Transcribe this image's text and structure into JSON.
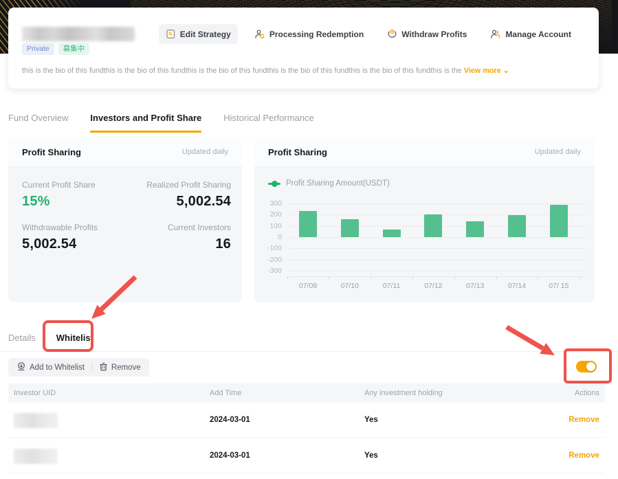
{
  "header": {
    "badges": [
      {
        "label": "Private"
      },
      {
        "label": "募集中"
      }
    ],
    "bio": "this is the bio of this fundthis is the bio of this fundthis is the bio of this fundthis is the bio of this fundthis is the bio of this fundthis is the",
    "view_more": "View more",
    "actions": [
      {
        "label": "Edit Strategy",
        "icon": "edit-strategy-icon"
      },
      {
        "label": "Processing Redemption",
        "icon": "processing-redemption-icon"
      },
      {
        "label": "Withdraw Profits",
        "icon": "withdraw-profits-icon"
      },
      {
        "label": "Manage Account",
        "icon": "manage-account-icon"
      }
    ]
  },
  "tabs": {
    "items": [
      {
        "label": "Fund Overview",
        "active": false
      },
      {
        "label": "Investors and Profit Share",
        "active": true
      },
      {
        "label": "Historical Performance",
        "active": false
      }
    ]
  },
  "stats_card": {
    "title": "Profit Sharing",
    "updated": "Updated daily",
    "items": [
      {
        "label": "Current Profit Share",
        "value": "15%"
      },
      {
        "label": "Realized Profit Sharing",
        "value": "5,002.54"
      },
      {
        "label": "Withdrawable Profits",
        "value": "5,002.54"
      },
      {
        "label": "Current Investors",
        "value": "16"
      }
    ]
  },
  "chart_card": {
    "title": "Profit Sharing",
    "updated": "Updated daily"
  },
  "chart_data": {
    "type": "bar",
    "title": "Profit Sharing",
    "legend": "Profit Sharing Amount(USDT)",
    "categories": [
      "07/09",
      "07/10",
      "07/11",
      "07/12",
      "07/13",
      "07/14",
      "07/ 15"
    ],
    "values": [
      230,
      160,
      70,
      205,
      140,
      195,
      285
    ],
    "yticks": [
      300,
      200,
      100,
      0,
      -100,
      -200,
      -300
    ],
    "ylim": [
      -300,
      300
    ],
    "grid": true,
    "legend_position": "top-left"
  },
  "section": {
    "subtabs": [
      {
        "label": "Details",
        "active": false
      },
      {
        "label": "Whitelist",
        "active": true
      }
    ]
  },
  "toolbar": {
    "add_label": "Add to Whitelist",
    "remove_label": "Remove",
    "whitelist_toggle_on": true
  },
  "table": {
    "headers": [
      "Investor UID",
      "Add Time",
      "Any investment holding",
      "Actions"
    ],
    "rows": [
      {
        "uid_blurred": true,
        "add_time": "2024-03-01",
        "holding": "Yes",
        "action": "Remove"
      },
      {
        "uid_blurred": true,
        "add_time": "2024-03-01",
        "holding": "Yes",
        "action": "Remove"
      }
    ]
  },
  "colors": {
    "accent_orange": "#F7A600",
    "green": "#20B26C",
    "bar_green": "#54C08F",
    "annotation_red": "#F0524C",
    "dark_band": "#141518"
  }
}
